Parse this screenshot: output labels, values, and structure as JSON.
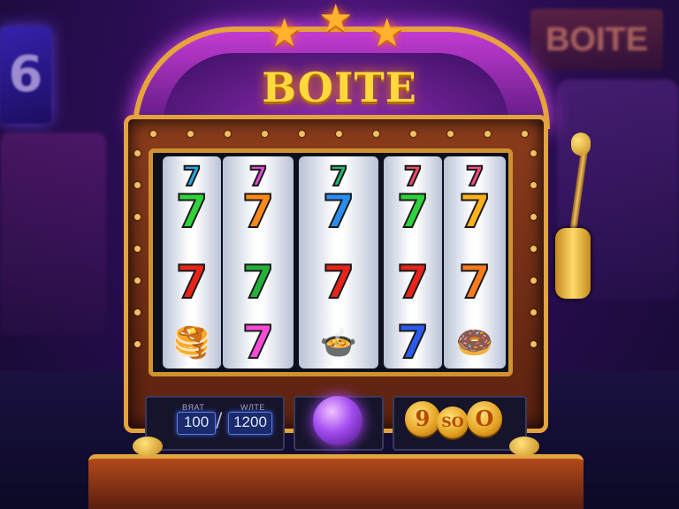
{
  "background": {
    "left_sign_text": "6",
    "right_sign_text": "BOITE"
  },
  "machine": {
    "title": "BOITE",
    "stars": [
      "★",
      "★",
      "★"
    ],
    "accent": "#e3a33e",
    "reels": [
      {
        "symbols": [
          {
            "t": "7",
            "c": "#29a8e8"
          },
          {
            "t": "7",
            "c": "#2fd23a"
          },
          {
            "t": "7",
            "c": "#e8231a"
          },
          {
            "t": "🥞",
            "c": "#d8a040"
          }
        ]
      },
      {
        "symbols": [
          {
            "t": "7",
            "c": "#e14bd6"
          },
          {
            "t": "7",
            "c": "#ff8a1a"
          },
          {
            "t": "7",
            "c": "#22b23a"
          },
          {
            "t": "7",
            "c": "#ff4ad8"
          }
        ]
      },
      {
        "symbols": [
          {
            "t": "7",
            "c": "#22b870"
          },
          {
            "t": "7",
            "c": "#2a8ef0"
          },
          {
            "t": "7",
            "c": "#e8231a"
          },
          {
            "t": "🍲",
            "c": "#c83a2a"
          }
        ]
      },
      {
        "symbols": [
          {
            "t": "7",
            "c": "#f04b6a"
          },
          {
            "t": "7",
            "c": "#2fd23a"
          },
          {
            "t": "7",
            "c": "#e8231a"
          },
          {
            "t": "7",
            "c": "#2a5af0"
          }
        ]
      },
      {
        "symbols": [
          {
            "t": "7",
            "c": "#ff4a8a"
          },
          {
            "t": "7",
            "c": "#ffb01a"
          },
          {
            "t": "7",
            "c": "#ff7a1a"
          },
          {
            "t": "🍩",
            "c": "#e8801a"
          }
        ]
      }
    ]
  },
  "panel": {
    "bet_label": "BЯAT",
    "bet_value": "100",
    "separator": "/",
    "win_label": "WЛTE",
    "win_value": "1200",
    "coins": [
      "9",
      "SO",
      "O"
    ]
  },
  "icons": {
    "spin_button": "purple-orb",
    "lever": "slot-lever"
  }
}
